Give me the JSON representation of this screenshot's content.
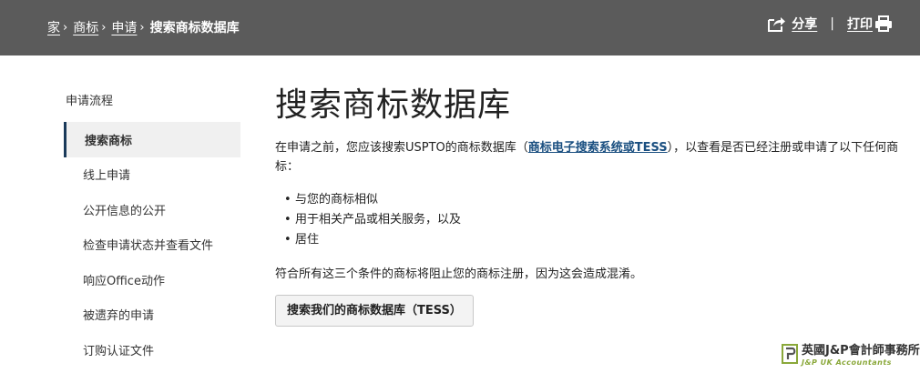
{
  "breadcrumb": {
    "items": [
      "家",
      "商标",
      "申请"
    ],
    "current": "搜索商标数据库"
  },
  "tools": {
    "share_label": "分享",
    "divider": "|",
    "print_label": "打印"
  },
  "sidebar": {
    "title": "申请流程",
    "items": [
      {
        "label": "搜索商标",
        "active": true
      },
      {
        "label": "线上申请"
      },
      {
        "label": "公开信息的公开"
      },
      {
        "label": "检查申请状态并查看文件"
      },
      {
        "label": "响应Office动作"
      },
      {
        "label": "被遗弃的申请"
      },
      {
        "label": "订购认证文件"
      }
    ]
  },
  "main": {
    "title": "搜索商标数据库",
    "intro_before": "在申请之前，您应该搜索USPTO的商标数据库（",
    "intro_link": "商标电子搜索系统或TESS",
    "intro_after": "），以查看是否已经注册或申请了以下任何商标：",
    "bullets": [
      "与您的商标相似",
      "用于相关产品或相关服务，以及",
      "居住"
    ],
    "conclusion": "符合所有这三个条件的商标将阻止您的商标注册，因为这会造成混淆。",
    "button_label": "搜索我们的商标数据库（TESS）"
  },
  "watermark": {
    "cn": "英國J&P會計師事務所",
    "en": "J&P UK Accountants",
    "logo_color": "#8aa83a"
  },
  "colors": {
    "header_bg": "#5b5b5b",
    "link": "#1a4f80",
    "active_border": "#1a3a5a"
  }
}
